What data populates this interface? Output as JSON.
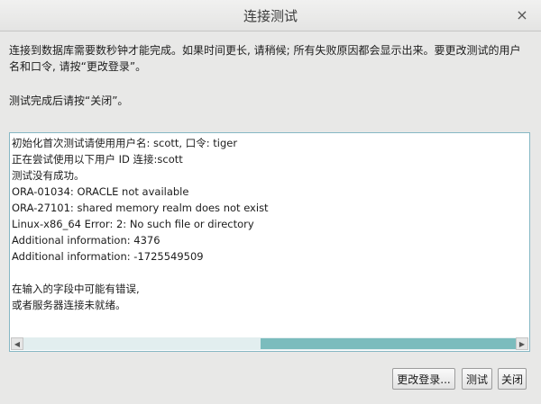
{
  "window": {
    "title": "连接测试",
    "close_glyph": "×"
  },
  "intro": {
    "text": "连接到数据库需要数秒钟才能完成。如果时间更长, 请稍候; 所有失败原因都会显示出来。要更改测试的用户名和口令, 请按“更改登录”。",
    "done_text": "测试完成后请按“关闭”。"
  },
  "output": {
    "lines": [
      "初始化首次测试请使用用户名: scott, 口令: tiger",
      "正在尝试使用以下用户 ID 连接:scott",
      "测试没有成功。",
      "ORA-01034: ORACLE not available",
      "ORA-27101: shared memory realm does not exist",
      "Linux-x86_64 Error: 2: No such file or directory",
      "Additional information: 4376",
      "Additional information: -1725549509",
      "",
      "在输入的字段中可能有错误,",
      "或者服务器连接未就绪。"
    ],
    "scroll_left_glyph": "◀",
    "scroll_right_glyph": "▶",
    "scroll_position": 0.5
  },
  "buttons": {
    "change_login": "更改登录...",
    "test": "测试",
    "close": "关闭"
  },
  "colors": {
    "scrollbar_thumb": "#7bbcbd",
    "border_accent": "#86b7c4"
  }
}
